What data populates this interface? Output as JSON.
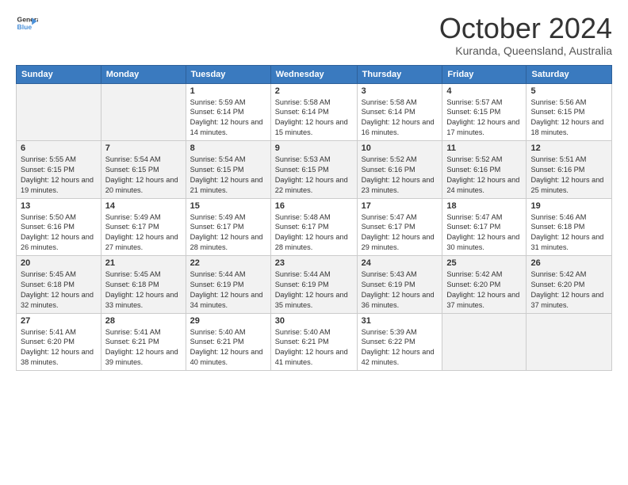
{
  "logo": {
    "line1": "General",
    "line2": "Blue"
  },
  "title": "October 2024",
  "location": "Kuranda, Queensland, Australia",
  "days_of_week": [
    "Sunday",
    "Monday",
    "Tuesday",
    "Wednesday",
    "Thursday",
    "Friday",
    "Saturday"
  ],
  "weeks": [
    [
      {
        "day": "",
        "info": ""
      },
      {
        "day": "",
        "info": ""
      },
      {
        "day": "1",
        "info": "Sunrise: 5:59 AM\nSunset: 6:14 PM\nDaylight: 12 hours and 14 minutes."
      },
      {
        "day": "2",
        "info": "Sunrise: 5:58 AM\nSunset: 6:14 PM\nDaylight: 12 hours and 15 minutes."
      },
      {
        "day": "3",
        "info": "Sunrise: 5:58 AM\nSunset: 6:14 PM\nDaylight: 12 hours and 16 minutes."
      },
      {
        "day": "4",
        "info": "Sunrise: 5:57 AM\nSunset: 6:15 PM\nDaylight: 12 hours and 17 minutes."
      },
      {
        "day": "5",
        "info": "Sunrise: 5:56 AM\nSunset: 6:15 PM\nDaylight: 12 hours and 18 minutes."
      }
    ],
    [
      {
        "day": "6",
        "info": "Sunrise: 5:55 AM\nSunset: 6:15 PM\nDaylight: 12 hours and 19 minutes."
      },
      {
        "day": "7",
        "info": "Sunrise: 5:54 AM\nSunset: 6:15 PM\nDaylight: 12 hours and 20 minutes."
      },
      {
        "day": "8",
        "info": "Sunrise: 5:54 AM\nSunset: 6:15 PM\nDaylight: 12 hours and 21 minutes."
      },
      {
        "day": "9",
        "info": "Sunrise: 5:53 AM\nSunset: 6:15 PM\nDaylight: 12 hours and 22 minutes."
      },
      {
        "day": "10",
        "info": "Sunrise: 5:52 AM\nSunset: 6:16 PM\nDaylight: 12 hours and 23 minutes."
      },
      {
        "day": "11",
        "info": "Sunrise: 5:52 AM\nSunset: 6:16 PM\nDaylight: 12 hours and 24 minutes."
      },
      {
        "day": "12",
        "info": "Sunrise: 5:51 AM\nSunset: 6:16 PM\nDaylight: 12 hours and 25 minutes."
      }
    ],
    [
      {
        "day": "13",
        "info": "Sunrise: 5:50 AM\nSunset: 6:16 PM\nDaylight: 12 hours and 26 minutes."
      },
      {
        "day": "14",
        "info": "Sunrise: 5:49 AM\nSunset: 6:17 PM\nDaylight: 12 hours and 27 minutes."
      },
      {
        "day": "15",
        "info": "Sunrise: 5:49 AM\nSunset: 6:17 PM\nDaylight: 12 hours and 28 minutes."
      },
      {
        "day": "16",
        "info": "Sunrise: 5:48 AM\nSunset: 6:17 PM\nDaylight: 12 hours and 28 minutes."
      },
      {
        "day": "17",
        "info": "Sunrise: 5:47 AM\nSunset: 6:17 PM\nDaylight: 12 hours and 29 minutes."
      },
      {
        "day": "18",
        "info": "Sunrise: 5:47 AM\nSunset: 6:17 PM\nDaylight: 12 hours and 30 minutes."
      },
      {
        "day": "19",
        "info": "Sunrise: 5:46 AM\nSunset: 6:18 PM\nDaylight: 12 hours and 31 minutes."
      }
    ],
    [
      {
        "day": "20",
        "info": "Sunrise: 5:45 AM\nSunset: 6:18 PM\nDaylight: 12 hours and 32 minutes."
      },
      {
        "day": "21",
        "info": "Sunrise: 5:45 AM\nSunset: 6:18 PM\nDaylight: 12 hours and 33 minutes."
      },
      {
        "day": "22",
        "info": "Sunrise: 5:44 AM\nSunset: 6:19 PM\nDaylight: 12 hours and 34 minutes."
      },
      {
        "day": "23",
        "info": "Sunrise: 5:44 AM\nSunset: 6:19 PM\nDaylight: 12 hours and 35 minutes."
      },
      {
        "day": "24",
        "info": "Sunrise: 5:43 AM\nSunset: 6:19 PM\nDaylight: 12 hours and 36 minutes."
      },
      {
        "day": "25",
        "info": "Sunrise: 5:42 AM\nSunset: 6:20 PM\nDaylight: 12 hours and 37 minutes."
      },
      {
        "day": "26",
        "info": "Sunrise: 5:42 AM\nSunset: 6:20 PM\nDaylight: 12 hours and 37 minutes."
      }
    ],
    [
      {
        "day": "27",
        "info": "Sunrise: 5:41 AM\nSunset: 6:20 PM\nDaylight: 12 hours and 38 minutes."
      },
      {
        "day": "28",
        "info": "Sunrise: 5:41 AM\nSunset: 6:21 PM\nDaylight: 12 hours and 39 minutes."
      },
      {
        "day": "29",
        "info": "Sunrise: 5:40 AM\nSunset: 6:21 PM\nDaylight: 12 hours and 40 minutes."
      },
      {
        "day": "30",
        "info": "Sunrise: 5:40 AM\nSunset: 6:21 PM\nDaylight: 12 hours and 41 minutes."
      },
      {
        "day": "31",
        "info": "Sunrise: 5:39 AM\nSunset: 6:22 PM\nDaylight: 12 hours and 42 minutes."
      },
      {
        "day": "",
        "info": ""
      },
      {
        "day": "",
        "info": ""
      }
    ]
  ]
}
